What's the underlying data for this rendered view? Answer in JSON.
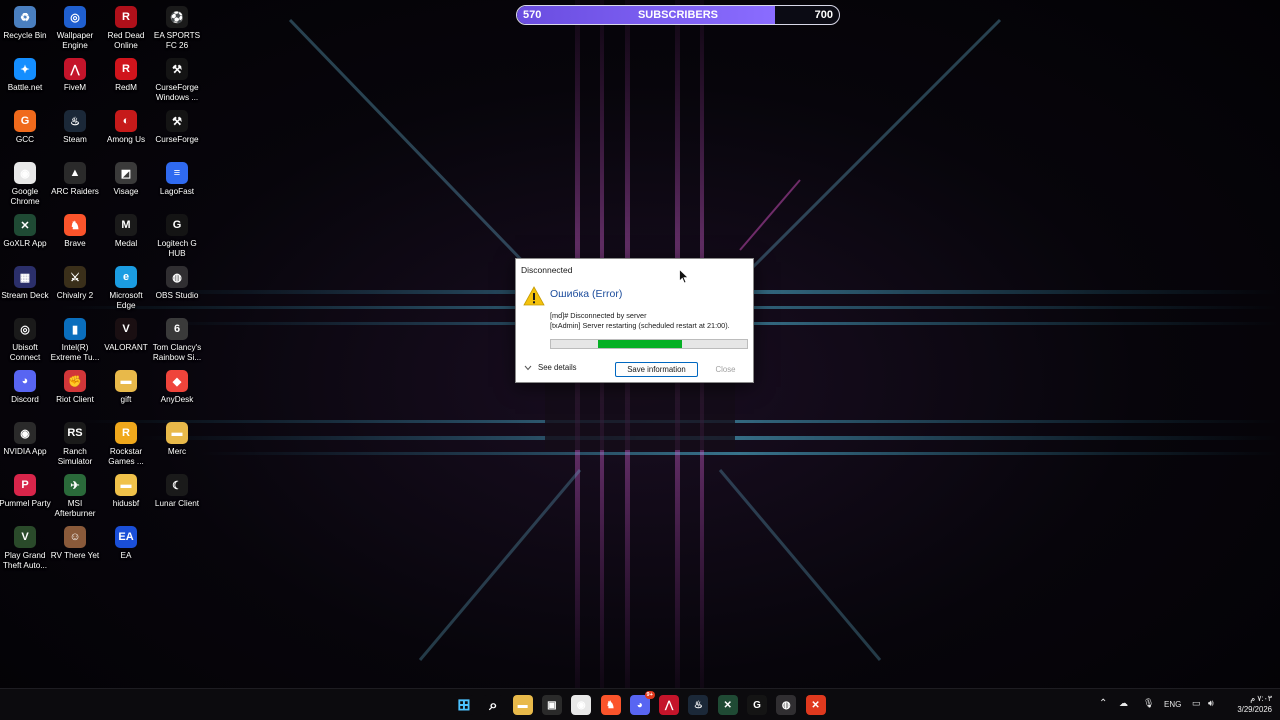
{
  "overlay": {
    "subscribers_current": "570",
    "subscribers_label": "SUBSCRIBERS",
    "subscribers_goal": "700",
    "progress_fraction": 0.8
  },
  "desktop_icons": [
    {
      "label": "Recycle Bin",
      "icon": "recycle-bin-icon",
      "color": "#4a7fc0",
      "glyph": "♻"
    },
    {
      "label": "Wallpaper Engine",
      "icon": "wallpaper-engine-icon",
      "color": "#1f5fcf",
      "glyph": "◎"
    },
    {
      "label": "Red Dead Online",
      "icon": "red-dead-online-icon",
      "color": "#b0101a",
      "glyph": "R"
    },
    {
      "label": "EA SPORTS FC 26",
      "icon": "ea-sports-fc-icon",
      "color": "#1a1a1a",
      "glyph": "⚽"
    },
    {
      "label": "Battle.net",
      "icon": "battlenet-icon",
      "color": "#148eff",
      "glyph": "✦"
    },
    {
      "label": "FiveM",
      "icon": "fivem-icon",
      "color": "#c4142a",
      "glyph": "⋀"
    },
    {
      "label": "RedM",
      "icon": "redm-icon",
      "color": "#d0141c",
      "glyph": "R"
    },
    {
      "label": "CurseForge Windows ...",
      "icon": "curseforge-windows-icon",
      "color": "#141414",
      "glyph": "⚒"
    },
    {
      "label": "GCC",
      "icon": "gcc-icon",
      "color": "#f06a1c",
      "glyph": "G"
    },
    {
      "label": "Steam",
      "icon": "steam-icon",
      "color": "#1b2838",
      "glyph": "♨"
    },
    {
      "label": "Among Us",
      "icon": "among-us-icon",
      "color": "#c61a1a",
      "glyph": "◐"
    },
    {
      "label": "CurseForge",
      "icon": "curseforge-icon",
      "color": "#141414",
      "glyph": "⚒"
    },
    {
      "label": "Google Chrome",
      "icon": "google-chrome-icon",
      "color": "#e8e8e8",
      "glyph": "◉"
    },
    {
      "label": "ARC Raiders",
      "icon": "arc-raiders-icon",
      "color": "#2a2a2a",
      "glyph": "▲"
    },
    {
      "label": "Visage",
      "icon": "visage-icon",
      "color": "#3a3a3a",
      "glyph": "◩"
    },
    {
      "label": "LagoFast",
      "icon": "lagofast-icon",
      "color": "#2f6af0",
      "glyph": "≡"
    },
    {
      "label": "GoXLR App",
      "icon": "goxlr-icon",
      "color": "#1f4a34",
      "glyph": "✕"
    },
    {
      "label": "Brave",
      "icon": "brave-icon",
      "color": "#fb542b",
      "glyph": "♞"
    },
    {
      "label": "Medal",
      "icon": "medal-icon",
      "color": "#1a1a1a",
      "glyph": "M"
    },
    {
      "label": "Logitech G HUB",
      "icon": "logitech-ghub-icon",
      "color": "#141414",
      "glyph": "G"
    },
    {
      "label": "Stream Deck",
      "icon": "stream-deck-icon",
      "color": "#2b2f6a",
      "glyph": "▦"
    },
    {
      "label": "Chivalry 2",
      "icon": "chivalry-icon",
      "color": "#3a2f1a",
      "glyph": "⚔"
    },
    {
      "label": "Microsoft Edge",
      "icon": "microsoft-edge-icon",
      "color": "#1b9de2",
      "glyph": "e"
    },
    {
      "label": "OBS Studio",
      "icon": "obs-studio-icon",
      "color": "#302e31",
      "glyph": "◍"
    },
    {
      "label": "Ubisoft Connect",
      "icon": "ubisoft-connect-icon",
      "color": "#1a1a1a",
      "glyph": "◎"
    },
    {
      "label": "Intel(R) Extreme Tu...",
      "icon": "intel-xtu-icon",
      "color": "#0a6ebd",
      "glyph": "▮"
    },
    {
      "label": "VALORANT",
      "icon": "valorant-icon",
      "color": "#1a0f12",
      "glyph": "V"
    },
    {
      "label": "Tom Clancy's Rainbow Si...",
      "icon": "rainbow-six-icon",
      "color": "#3a3a3a",
      "glyph": "6"
    },
    {
      "label": "Discord",
      "icon": "discord-icon",
      "color": "#5865f2",
      "glyph": "◕"
    },
    {
      "label": "Riot Client",
      "icon": "riot-client-icon",
      "color": "#d13639",
      "glyph": "✊"
    },
    {
      "label": "gift",
      "icon": "folder-icon",
      "color": "#e8b94a",
      "glyph": "▬"
    },
    {
      "label": "AnyDesk",
      "icon": "anydesk-icon",
      "color": "#ef443b",
      "glyph": "◆"
    },
    {
      "label": "NVIDIA App",
      "icon": "nvidia-app-icon",
      "color": "#2a2a2a",
      "glyph": "◉"
    },
    {
      "label": "Ranch Simulator",
      "icon": "ranch-simulator-icon",
      "color": "#1a1a1a",
      "glyph": "RS"
    },
    {
      "label": "Rockstar Games ...",
      "icon": "rockstar-games-icon",
      "color": "#f0a81c",
      "glyph": "R"
    },
    {
      "label": "Merc",
      "icon": "folder-icon",
      "color": "#e8b94a",
      "glyph": "▬"
    },
    {
      "label": "Pummel Party",
      "icon": "pummel-party-icon",
      "color": "#d8254a",
      "glyph": "P"
    },
    {
      "label": "MSI Afterburner",
      "icon": "msi-afterburner-icon",
      "color": "#2a6a3a",
      "glyph": "✈"
    },
    {
      "label": "hidusbf",
      "icon": "folder-icon",
      "color": "#f0c24a",
      "glyph": "▬"
    },
    {
      "label": "Lunar Client",
      "icon": "lunar-client-icon",
      "color": "#1a1a1a",
      "glyph": "☾"
    },
    {
      "label": "Play Grand Theft Auto...",
      "icon": "gta-icon",
      "color": "#2a4a2a",
      "glyph": "V"
    },
    {
      "label": "RV There Yet",
      "icon": "rv-there-yet-icon",
      "color": "#8a5a3a",
      "glyph": "☺"
    },
    {
      "label": "EA",
      "icon": "ea-icon",
      "color": "#1a4fd8",
      "glyph": "EA"
    }
  ],
  "dialog": {
    "title": "Disconnected",
    "heading": "Ошибка (Error)",
    "line1": "[md]# Disconnected by server",
    "line2": "[txAdmin] Server restarting (scheduled restart at 21:00).",
    "progress_fraction": 0.43,
    "see_details": "See details",
    "save_button": "Save information",
    "close_button": "Close",
    "heading_color": "#1c4c9c",
    "progress_color": "#06b025"
  },
  "taskbar": {
    "apps": [
      {
        "icon": "windows-start-icon",
        "color": "#0c0b0e",
        "glyph": "⊞"
      },
      {
        "icon": "search-icon",
        "color": "#0c0b0e",
        "glyph": "⌕"
      },
      {
        "icon": "file-explorer-icon",
        "color": "#e8b94a",
        "glyph": "▬"
      },
      {
        "icon": "microsoft-store-icon",
        "color": "#2a2a2a",
        "glyph": "▣"
      },
      {
        "icon": "google-chrome-icon",
        "color": "#e8e8e8",
        "glyph": "◉"
      },
      {
        "icon": "brave-icon",
        "color": "#fb542b",
        "glyph": "♞"
      },
      {
        "icon": "discord-icon",
        "color": "#5865f2",
        "glyph": "◕"
      },
      {
        "icon": "fivem-icon",
        "color": "#c4142a",
        "glyph": "⋀"
      },
      {
        "icon": "steam-icon",
        "color": "#1b2838",
        "glyph": "♨"
      },
      {
        "icon": "goxlr-icon",
        "color": "#1f4a34",
        "glyph": "✕"
      },
      {
        "icon": "logitech-ghub-icon",
        "color": "#141414",
        "glyph": "G"
      },
      {
        "icon": "obs-studio-icon",
        "color": "#302e31",
        "glyph": "◍"
      },
      {
        "icon": "fivem-error-icon",
        "color": "#e0391e",
        "glyph": "✕"
      }
    ],
    "discord_badge": "9+",
    "tray": {
      "language": "ENG",
      "time": "٧:٠٣ م",
      "date": "3/29/2026"
    }
  }
}
